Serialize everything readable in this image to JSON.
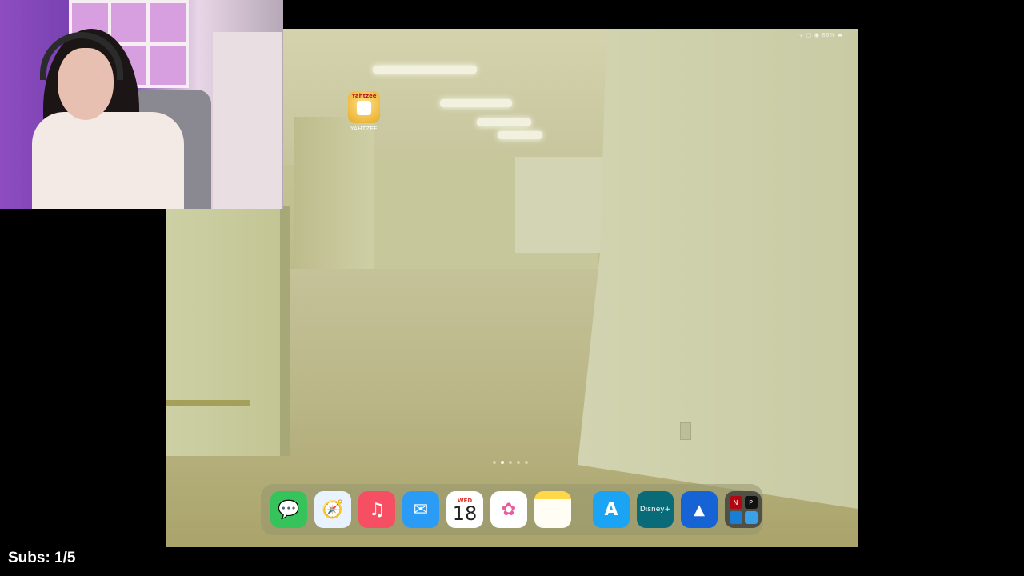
{
  "status_bar": {
    "text": "ᯤ ▢ ◉ 86% ▬"
  },
  "home_screen": {
    "apps": [
      {
        "name": "yahtzee-icon",
        "icon_title": "Yahtzee",
        "label": "YAHTZEE"
      }
    ],
    "page_count": 5,
    "active_page": 2
  },
  "dock": {
    "apps": [
      {
        "name": "messages-icon",
        "glyph": "💬",
        "color": "#36c35b"
      },
      {
        "name": "safari-icon",
        "glyph": "🧭",
        "color": "#2f8df0"
      },
      {
        "name": "music-icon",
        "glyph": "♫",
        "color": "#f64f64"
      },
      {
        "name": "mail-icon",
        "glyph": "✉",
        "color": "#2a9cf6"
      },
      {
        "name": "calendar-icon",
        "dow": "WED",
        "day": "18"
      },
      {
        "name": "photos-icon",
        "glyph": "✿"
      },
      {
        "name": "notes-icon"
      }
    ],
    "recent": [
      {
        "name": "app-store-icon",
        "glyph": "A",
        "color": "#1ba3f4"
      },
      {
        "name": "disney-plus-icon",
        "glyph": "Disney+",
        "color": "#0a6b78"
      },
      {
        "name": "paramount-plus-icon",
        "glyph": "▲",
        "color": "#1663d6"
      }
    ]
  },
  "overlay": {
    "subs_text": "Subs: 1/5"
  }
}
